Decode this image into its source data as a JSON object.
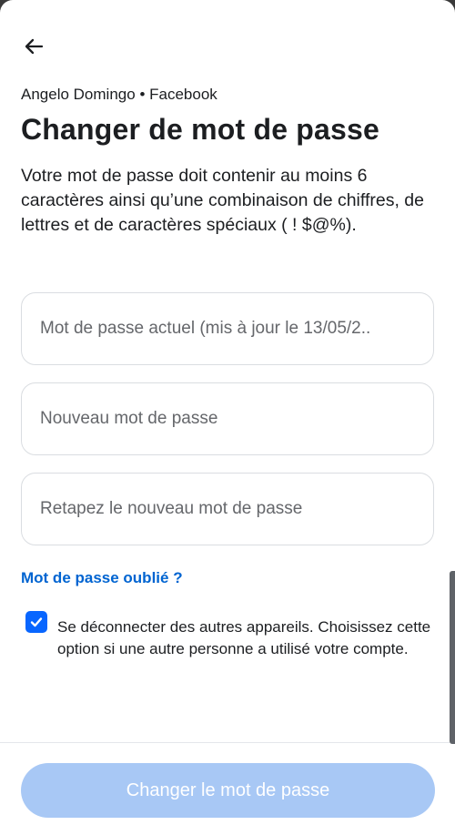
{
  "header": {
    "back_icon": "arrow-left-icon",
    "account_name": "Angelo Domingo",
    "separator": "•",
    "service": "Facebook"
  },
  "page": {
    "title": "Changer de mot de passe",
    "description": "Votre mot de passe doit contenir au moins 6 caractères ainsi qu’une combinaison de chiffres, de lettres et de caractères spéciaux ( ! $@%)."
  },
  "form": {
    "current_password_placeholder": "Mot de passe actuel (mis à jour le 13/05/2..",
    "new_password_placeholder": "Nouveau mot de passe",
    "retype_password_placeholder": "Retapez le nouveau mot de passe",
    "forgot_password_label": "Mot de passe oublié ?",
    "logout_others_checked": true,
    "logout_others_label": "Se déconnecter des autres appareils. Choisissez cette option si une autre personne a utilisé votre compte.",
    "submit_label": "Changer le mot de passe"
  },
  "colors": {
    "accent": "#0866ff",
    "link": "#0064d1",
    "button_disabled": "#a8c8f5",
    "text": "#1c1e21",
    "placeholder": "#65676b"
  }
}
